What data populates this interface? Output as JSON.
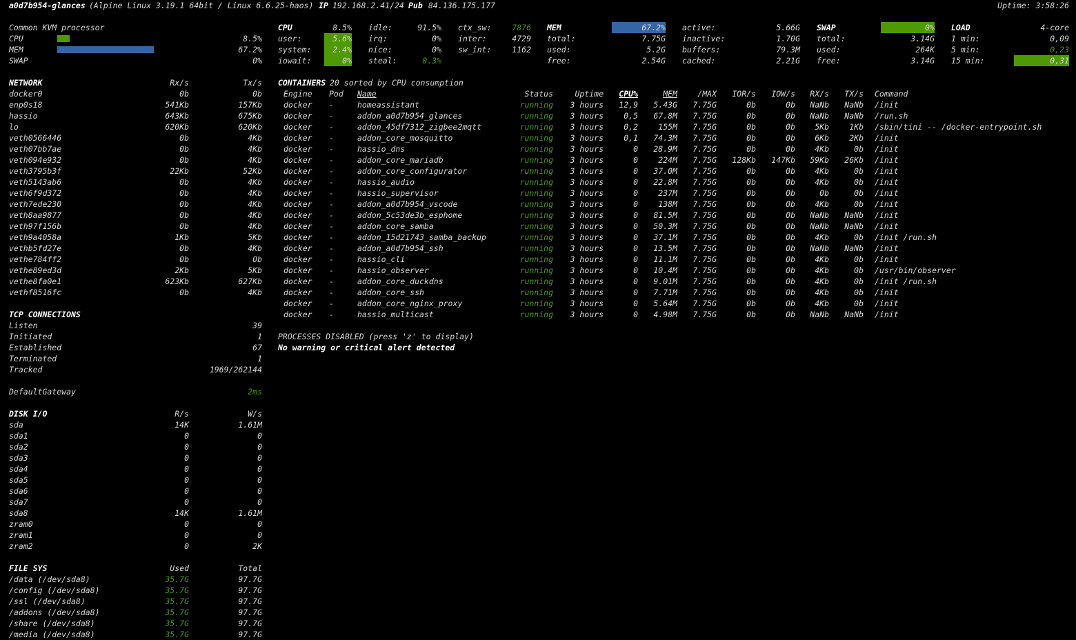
{
  "header": {
    "hostname": "a0d7b954-glances",
    "system": "(Alpine Linux 3.19.1 64bit / Linux 6.6.25-haos)",
    "ip_label": "IP",
    "ip": "192.168.2.41/24",
    "pub_label": "Pub",
    "pub": "84.136.175.177",
    "uptime": "Uptime: 3:58:26"
  },
  "quicklook": {
    "title": "Common KVM processor",
    "rows": [
      {
        "label": "CPU",
        "value": "8.5%",
        "fill": 0.085
      },
      {
        "label": "MEM",
        "value": "67.2%",
        "fill": 0.672
      },
      {
        "label": "SWAP",
        "value": "0%",
        "fill": 0.0
      }
    ]
  },
  "cpu": {
    "title": "CPU",
    "total": "8.5%",
    "rows": [
      [
        "user:",
        "5.6%",
        "irq:",
        "0%",
        "inter:",
        "4729"
      ],
      [
        "system:",
        "2.4%",
        "nice:",
        "0%",
        "sw_int:",
        "1162"
      ],
      [
        "iowait:",
        "0%",
        "steal:",
        "0.3%",
        "",
        ""
      ]
    ],
    "idle_label": "idle:",
    "idle": "91.5%",
    "ctx_label": "ctx_sw:",
    "ctx": "7876"
  },
  "mem": {
    "title": "MEM",
    "percent": "67.2%",
    "rows": [
      [
        "total:",
        "7.75G",
        "inactive:",
        "1.70G"
      ],
      [
        "used:",
        "5.2G",
        "buffers:",
        "79.3M"
      ],
      [
        "free:",
        "2.54G",
        "cached:",
        "2.21G"
      ]
    ],
    "active_label": "active:",
    "active": "5.66G"
  },
  "swap": {
    "title": "SWAP",
    "percent": "0%",
    "rows": [
      [
        "total:",
        "3.14G"
      ],
      [
        "used:",
        "264K"
      ],
      [
        "free:",
        "3.14G"
      ]
    ]
  },
  "load": {
    "title": "LOAD",
    "cores": "4-core",
    "rows": [
      [
        "1 min:",
        "0,09"
      ],
      [
        "5 min:",
        "0,23"
      ],
      [
        "15 min:",
        "0,31"
      ]
    ]
  },
  "network": {
    "title": "NETWORK",
    "rx": "Rx/s",
    "tx": "Tx/s",
    "rows": [
      [
        "docker0",
        "0b",
        "0b"
      ],
      [
        "enp0s18",
        "541Kb",
        "157Kb"
      ],
      [
        "hassio",
        "643Kb",
        "675Kb"
      ],
      [
        "lo",
        "620Kb",
        "620Kb"
      ],
      [
        "veth0566446",
        "0b",
        "4Kb"
      ],
      [
        "veth07bb7ae",
        "0b",
        "4Kb"
      ],
      [
        "veth094e932",
        "0b",
        "4Kb"
      ],
      [
        "veth3795b3f",
        "22Kb",
        "52Kb"
      ],
      [
        "veth5143ab6",
        "0b",
        "4Kb"
      ],
      [
        "veth6f9d372",
        "0b",
        "4Kb"
      ],
      [
        "veth7ede230",
        "0b",
        "4Kb"
      ],
      [
        "veth8aa9877",
        "0b",
        "4Kb"
      ],
      [
        "veth97f156b",
        "0b",
        "4Kb"
      ],
      [
        "veth9a4058a",
        "1Kb",
        "5Kb"
      ],
      [
        "vethb5fd27e",
        "0b",
        "4Kb"
      ],
      [
        "vethe784ff2",
        "0b",
        "0b"
      ],
      [
        "vethe89ed3d",
        "2Kb",
        "5Kb"
      ],
      [
        "vethe8fa0e1",
        "623Kb",
        "627Kb"
      ],
      [
        "vethf8516fc",
        "0b",
        "4Kb"
      ]
    ]
  },
  "tcp": {
    "title": "TCP CONNECTIONS",
    "rows": [
      [
        "Listen",
        "39"
      ],
      [
        "Initiated",
        "1"
      ],
      [
        "Established",
        "67"
      ],
      [
        "Terminated",
        "1"
      ],
      [
        "Tracked",
        "1969/262144"
      ]
    ]
  },
  "gateway": {
    "label": "DefaultGateway",
    "value": "2ms"
  },
  "diskio": {
    "title": "DISK I/O",
    "r": "R/s",
    "w": "W/s",
    "rows": [
      [
        "sda",
        "14K",
        "1.61M"
      ],
      [
        "sda1",
        "0",
        "0"
      ],
      [
        "sda2",
        "0",
        "0"
      ],
      [
        "sda3",
        "0",
        "0"
      ],
      [
        "sda4",
        "0",
        "0"
      ],
      [
        "sda5",
        "0",
        "0"
      ],
      [
        "sda6",
        "0",
        "0"
      ],
      [
        "sda7",
        "0",
        "0"
      ],
      [
        "sda8",
        "14K",
        "1.61M"
      ],
      [
        "zram0",
        "0",
        "0"
      ],
      [
        "zram1",
        "0",
        "0"
      ],
      [
        "zram2",
        "0",
        "2K"
      ]
    ]
  },
  "fs": {
    "title": "FILE SYS",
    "used": "Used",
    "total": "Total",
    "rows": [
      [
        "/data (/dev/sda8)",
        "35.7G",
        "97.7G"
      ],
      [
        "/config (/dev/sda8)",
        "35.7G",
        "97.7G"
      ],
      [
        "/ssl (/dev/sda8)",
        "35.7G",
        "97.7G"
      ],
      [
        "/addons (/dev/sda8)",
        "35.7G",
        "97.7G"
      ],
      [
        "/share (/dev/sda8)",
        "35.7G",
        "97.7G"
      ],
      [
        "/media (/dev/sda8)",
        "35.7G",
        "97.7G"
      ]
    ]
  },
  "containers": {
    "title": "CONTAINERS",
    "subtitle": "20 sorted by CPU consumption",
    "headers": [
      "Engine",
      "Pod",
      "Name",
      "Status",
      "Uptime",
      "CPU%",
      "MEM",
      "/MAX",
      "IOR/s",
      "IOW/s",
      "RX/s",
      "TX/s",
      "Command"
    ],
    "rows": [
      [
        "docker",
        "-",
        "homeassistant",
        "running",
        "3 hours",
        "12,9",
        "5.43G",
        "7.75G",
        "0b",
        "0b",
        "NaNb",
        "NaNb",
        "/init"
      ],
      [
        "docker",
        "-",
        "addon_a0d7b954_glances",
        "running",
        "3 hours",
        "0,5",
        "67.8M",
        "7.75G",
        "0b",
        "0b",
        "NaNb",
        "NaNb",
        "/run.sh"
      ],
      [
        "docker",
        "-",
        "addon_45df7312_zigbee2mqtt",
        "running",
        "3 hours",
        "0,2",
        "155M",
        "7.75G",
        "0b",
        "0b",
        "5Kb",
        "1Kb",
        "/sbin/tini -- /docker-entrypoint.sh"
      ],
      [
        "docker",
        "-",
        "addon_core_mosquitto",
        "running",
        "3 hours",
        "0,1",
        "74.3M",
        "7.75G",
        "0b",
        "0b",
        "6Kb",
        "2Kb",
        "/init"
      ],
      [
        "docker",
        "-",
        "hassio_dns",
        "running",
        "3 hours",
        "0",
        "28.9M",
        "7.75G",
        "0b",
        "0b",
        "4Kb",
        "0b",
        "/init"
      ],
      [
        "docker",
        "-",
        "addon_core_mariadb",
        "running",
        "3 hours",
        "0",
        "224M",
        "7.75G",
        "128Kb",
        "147Kb",
        "59Kb",
        "26Kb",
        "/init"
      ],
      [
        "docker",
        "-",
        "addon_core_configurator",
        "running",
        "3 hours",
        "0",
        "37.0M",
        "7.75G",
        "0b",
        "0b",
        "4Kb",
        "0b",
        "/init"
      ],
      [
        "docker",
        "-",
        "hassio_audio",
        "running",
        "3 hours",
        "0",
        "22.8M",
        "7.75G",
        "0b",
        "0b",
        "4Kb",
        "0b",
        "/init"
      ],
      [
        "docker",
        "-",
        "hassio_supervisor",
        "running",
        "3 hours",
        "0",
        "237M",
        "7.75G",
        "0b",
        "0b",
        "0b",
        "0b",
        "/init"
      ],
      [
        "docker",
        "-",
        "addon_a0d7b954_vscode",
        "running",
        "3 hours",
        "0",
        "138M",
        "7.75G",
        "0b",
        "0b",
        "4Kb",
        "0b",
        "/init"
      ],
      [
        "docker",
        "-",
        "addon_5c53de3b_esphome",
        "running",
        "3 hours",
        "0",
        "81.5M",
        "7.75G",
        "0b",
        "0b",
        "NaNb",
        "NaNb",
        "/init"
      ],
      [
        "docker",
        "-",
        "addon_core_samba",
        "running",
        "3 hours",
        "0",
        "50.3M",
        "7.75G",
        "0b",
        "0b",
        "NaNb",
        "NaNb",
        "/init"
      ],
      [
        "docker",
        "-",
        "addon_15d21743_samba_backup",
        "running",
        "3 hours",
        "0",
        "37.1M",
        "7.75G",
        "0b",
        "0b",
        "4Kb",
        "0b",
        "/init /run.sh"
      ],
      [
        "docker",
        "-",
        "addon_a0d7b954_ssh",
        "running",
        "3 hours",
        "0",
        "13.5M",
        "7.75G",
        "0b",
        "0b",
        "NaNb",
        "NaNb",
        "/init"
      ],
      [
        "docker",
        "-",
        "hassio_cli",
        "running",
        "3 hours",
        "0",
        "11.1M",
        "7.75G",
        "0b",
        "0b",
        "4Kb",
        "0b",
        "/init"
      ],
      [
        "docker",
        "-",
        "hassio_observer",
        "running",
        "3 hours",
        "0",
        "10.4M",
        "7.75G",
        "0b",
        "0b",
        "4Kb",
        "0b",
        "/usr/bin/observer"
      ],
      [
        "docker",
        "-",
        "addon_core_duckdns",
        "running",
        "3 hours",
        "0",
        "9.01M",
        "7.75G",
        "0b",
        "0b",
        "4Kb",
        "0b",
        "/init /run.sh"
      ],
      [
        "docker",
        "-",
        "addon_core_ssh",
        "running",
        "3 hours",
        "0",
        "7.71M",
        "7.75G",
        "0b",
        "0b",
        "4Kb",
        "0b",
        "/init"
      ],
      [
        "docker",
        "-",
        "addon_core_nginx_proxy",
        "running",
        "3 hours",
        "0",
        "5.64M",
        "7.75G",
        "0b",
        "0b",
        "4Kb",
        "0b",
        "/init"
      ],
      [
        "docker",
        "-",
        "hassio_multicast",
        "running",
        "3 hours",
        "0",
        "4.98M",
        "7.75G",
        "0b",
        "0b",
        "NaNb",
        "NaNb",
        "/init"
      ]
    ]
  },
  "processes_disabled": "PROCESSES DISABLED (press 'z' to display)",
  "alert": "No warning or critical alert detected",
  "colors": {
    "green": "#4e9a06",
    "blue": "#3465a4",
    "light_green": "#73d216"
  }
}
